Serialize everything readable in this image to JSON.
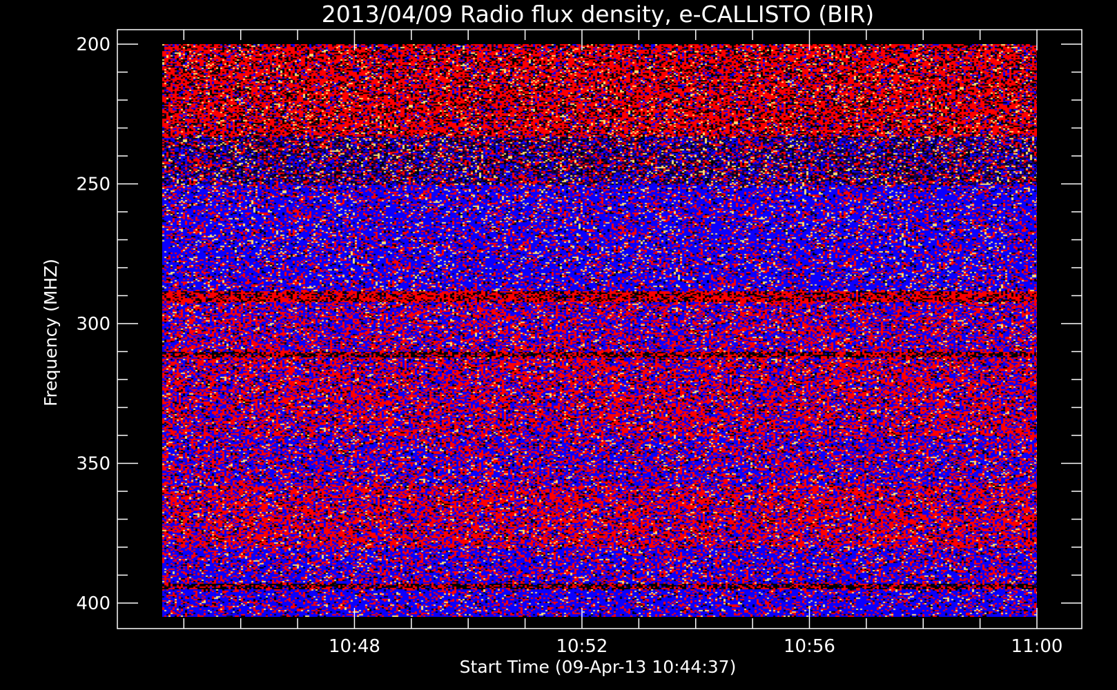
{
  "chart_data": {
    "type": "heatmap",
    "title": "2013/04/09  Radio flux density, e-CALLISTO (BIR)",
    "xlabel": "Start Time (09-Apr-13 10:44:37)",
    "ylabel": "Frequency (MHZ)",
    "x_start_min": 0,
    "x_end_min": 15.38,
    "ylim": [
      200,
      405
    ],
    "y_inverted": true,
    "x_ticks": [
      {
        "label": "10:48",
        "min": 3.38
      },
      {
        "label": "10:52",
        "min": 7.38
      },
      {
        "label": "10:56",
        "min": 11.38
      },
      {
        "label": "11:00",
        "min": 15.38
      }
    ],
    "y_ticks": [
      {
        "label": "200",
        "value": 200
      },
      {
        "label": "250",
        "value": 250
      },
      {
        "label": "300",
        "value": 300
      },
      {
        "label": "350",
        "value": 350
      },
      {
        "label": "400",
        "value": 400
      }
    ],
    "colormap": [
      "#000000",
      "#1a0044",
      "#0a00ff",
      "#ff0000",
      "#ffe070"
    ],
    "bands": [
      {
        "from": 200,
        "to": 233,
        "weights": [
          0.22,
          0.04,
          0.12,
          0.56,
          0.06
        ]
      },
      {
        "from": 233,
        "to": 250,
        "weights": [
          0.16,
          0.26,
          0.28,
          0.22,
          0.08
        ]
      },
      {
        "from": 250,
        "to": 288,
        "weights": [
          0.05,
          0.02,
          0.64,
          0.22,
          0.07
        ]
      },
      {
        "from": 288,
        "to": 292,
        "weights": [
          0.3,
          0.05,
          0.05,
          0.6,
          0.0
        ]
      },
      {
        "from": 292,
        "to": 310,
        "weights": [
          0.05,
          0.02,
          0.46,
          0.42,
          0.05
        ]
      },
      {
        "from": 310,
        "to": 312,
        "weights": [
          0.45,
          0.05,
          0.05,
          0.45,
          0.0
        ]
      },
      {
        "from": 312,
        "to": 340,
        "weights": [
          0.08,
          0.02,
          0.36,
          0.5,
          0.04
        ]
      },
      {
        "from": 340,
        "to": 358,
        "weights": [
          0.06,
          0.02,
          0.5,
          0.37,
          0.05
        ]
      },
      {
        "from": 358,
        "to": 380,
        "weights": [
          0.08,
          0.02,
          0.32,
          0.54,
          0.04
        ]
      },
      {
        "from": 380,
        "to": 393,
        "weights": [
          0.05,
          0.02,
          0.58,
          0.3,
          0.05
        ]
      },
      {
        "from": 393,
        "to": 395,
        "weights": [
          0.5,
          0.05,
          0.1,
          0.35,
          0.0
        ]
      },
      {
        "from": 395,
        "to": 405,
        "weights": [
          0.05,
          0.02,
          0.66,
          0.22,
          0.05
        ]
      }
    ]
  }
}
